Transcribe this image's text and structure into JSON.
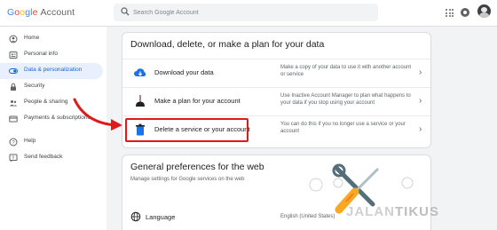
{
  "header": {
    "logo_letters": [
      "G",
      "o",
      "o",
      "g",
      "l",
      "e"
    ],
    "logo_suffix": "Account",
    "search_placeholder": "Search Google Account"
  },
  "sidebar": {
    "items": [
      {
        "label": "Home",
        "icon": "home-icon",
        "active": false
      },
      {
        "label": "Personal info",
        "icon": "personal-info-icon",
        "active": false
      },
      {
        "label": "Data & personalization",
        "icon": "toggle-icon",
        "active": true
      },
      {
        "label": "Security",
        "icon": "lock-icon",
        "active": false
      },
      {
        "label": "People & sharing",
        "icon": "people-icon",
        "active": false
      },
      {
        "label": "Payments & subscriptions",
        "icon": "card-icon",
        "active": false
      },
      {
        "label": "Help",
        "icon": "help-icon",
        "active": false
      },
      {
        "label": "Send feedback",
        "icon": "feedback-icon",
        "active": false
      }
    ]
  },
  "download_card": {
    "title": "Download, delete, or make a plan for your data",
    "rows": [
      {
        "label": "Download your data",
        "description": "Make a copy of your data to use it with another account or service",
        "icon": "cloud-download-icon"
      },
      {
        "label": "Make a plan for your account",
        "description": "Use Inactive Account Manager to plan what happens to your data if you stop using your account",
        "icon": "plunger-icon"
      },
      {
        "label": "Delete a service or your account",
        "description": "You can do this if you no longer use a service or your account",
        "icon": "trash-icon"
      }
    ]
  },
  "general_card": {
    "title": "General preferences for the web",
    "subtitle": "Manage settings for Google services on the web",
    "language_label": "Language",
    "language_value": "English (United States)"
  },
  "watermark": {
    "part1": "JALAN",
    "part2": "TIKUS"
  },
  "colors": {
    "accent": "#1967d2",
    "highlight": "#e0191b",
    "active_bg": "#e8f0fe"
  }
}
